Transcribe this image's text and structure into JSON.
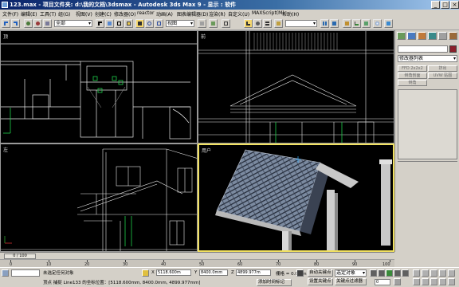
{
  "window": {
    "title": "123.max   - 项目文件夹: d:\\我的文档\\3dsmax   - Autodesk 3ds Max 9   - 显示 : 软件",
    "min_label": "_",
    "max_label": "□",
    "close_label": "×"
  },
  "menu": [
    "文件(F)",
    "编辑(E)",
    "工具(T)",
    "组(G)",
    "视图(V)",
    "创建(C)",
    "修改器(O)",
    "reactor",
    "动画(A)",
    "图表编辑器(D)",
    "渲染(R)",
    "自定义(U)",
    "MAXScript(M)",
    "帮助(H)"
  ],
  "toolbar": {
    "selection_filter": "全部",
    "reference_coord": "视图",
    "icons": [
      "undo-icon",
      "redo-icon",
      "link-icon",
      "unlink-icon",
      "bind-spacewarp-icon",
      "select-icon",
      "select-by-name-icon",
      "rect-select-icon",
      "window-crossing-icon",
      "move-icon",
      "rotate-icon",
      "scale-icon",
      "pivot-icon",
      "snap-icon",
      "angle-snap-icon",
      "percent-snap-icon",
      "spinner-snap-icon",
      "named-selection-icon",
      "mirror-icon",
      "align-icon",
      "layer-icon",
      "curve-editor-icon",
      "schematic-icon",
      "material-editor-icon",
      "render-scene-icon",
      "quick-render-icon"
    ]
  },
  "viewports": {
    "top": {
      "label": "顶"
    },
    "front": {
      "label": "前"
    },
    "left": {
      "label": "左"
    },
    "perspective": {
      "label": "用户"
    }
  },
  "command_panel": {
    "modifier_list": "修改器列表",
    "buttons": [
      "FFD 2x2x2",
      "挤出",
      "倒角剖面",
      "UVW 贴图",
      "倒角"
    ],
    "tabs": [
      "create-icon",
      "modify-icon",
      "hierarchy-icon",
      "motion-icon",
      "display-icon",
      "utilities-icon"
    ],
    "object_color": "#8a1f2a"
  },
  "timeline": {
    "frame_display": "0 / 100",
    "ticks": [
      "0",
      "10",
      "20",
      "30",
      "40",
      "50",
      "60",
      "70",
      "80",
      "90",
      "100"
    ]
  },
  "status": {
    "selection_info": "未选定任何对象",
    "prompt": "顶点 捕捉 Line133 的坐标位置：[5118.600mm, 8400.0mm, 4899.977mm]",
    "x_value": "5118.600m",
    "y_value": "8400.0mm",
    "z_value": "4899.977m",
    "grid": "栅格 = 0.0mm",
    "auto_key": "自动关键点",
    "set_key": "设置关键点",
    "selected_dropdown": "选定对象",
    "key_filters": "关键点过滤器",
    "add_time_tag": "添加时间标记",
    "frame_field": "0",
    "lock_icon": "lock-icon"
  },
  "colors": {
    "wire_white": "#e8e8e8",
    "wire_green": "#1fd04a",
    "viewport_active": "#f0e060"
  }
}
